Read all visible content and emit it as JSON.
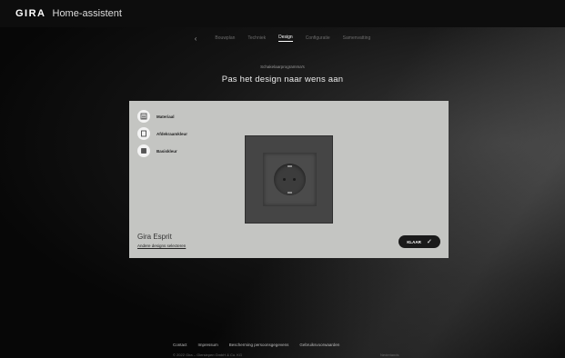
{
  "header": {
    "brand": "GIRA",
    "app_title": "Home-assistent"
  },
  "nav": {
    "back_icon": "chevron-left-icon",
    "tabs": [
      {
        "label": "Bouwplan",
        "active": false
      },
      {
        "label": "Techniek",
        "active": false
      },
      {
        "label": "Design",
        "active": true
      },
      {
        "label": "Configuratie",
        "active": false
      },
      {
        "label": "Samenvatting",
        "active": false
      }
    ]
  },
  "main": {
    "subtitle": "Schakelaarprogramma's",
    "title": "Pas het design naar wens aan"
  },
  "configurator": {
    "options": [
      {
        "label": "Materiaal",
        "icon": "material-icon"
      },
      {
        "label": "Afdekraamkleur",
        "icon": "frame-icon"
      },
      {
        "label": "Basiskleur",
        "icon": "base-color-icon"
      }
    ],
    "product_name": "Gira Esprit",
    "change_link": "Andere designs selecteren",
    "done_label": "KLAAR",
    "done_icon": "check-icon",
    "frame_color": "#454545",
    "insert_color": "#4b4b4b"
  },
  "footer": {
    "links": [
      "Contact",
      "Impressum",
      "Bescherming persoonsgegevens",
      "Gebruiksvoorwaarden"
    ],
    "copyright": "© 2022 Gira – Giersiepen GmbH & Co. KG",
    "language": "Nederlands"
  }
}
